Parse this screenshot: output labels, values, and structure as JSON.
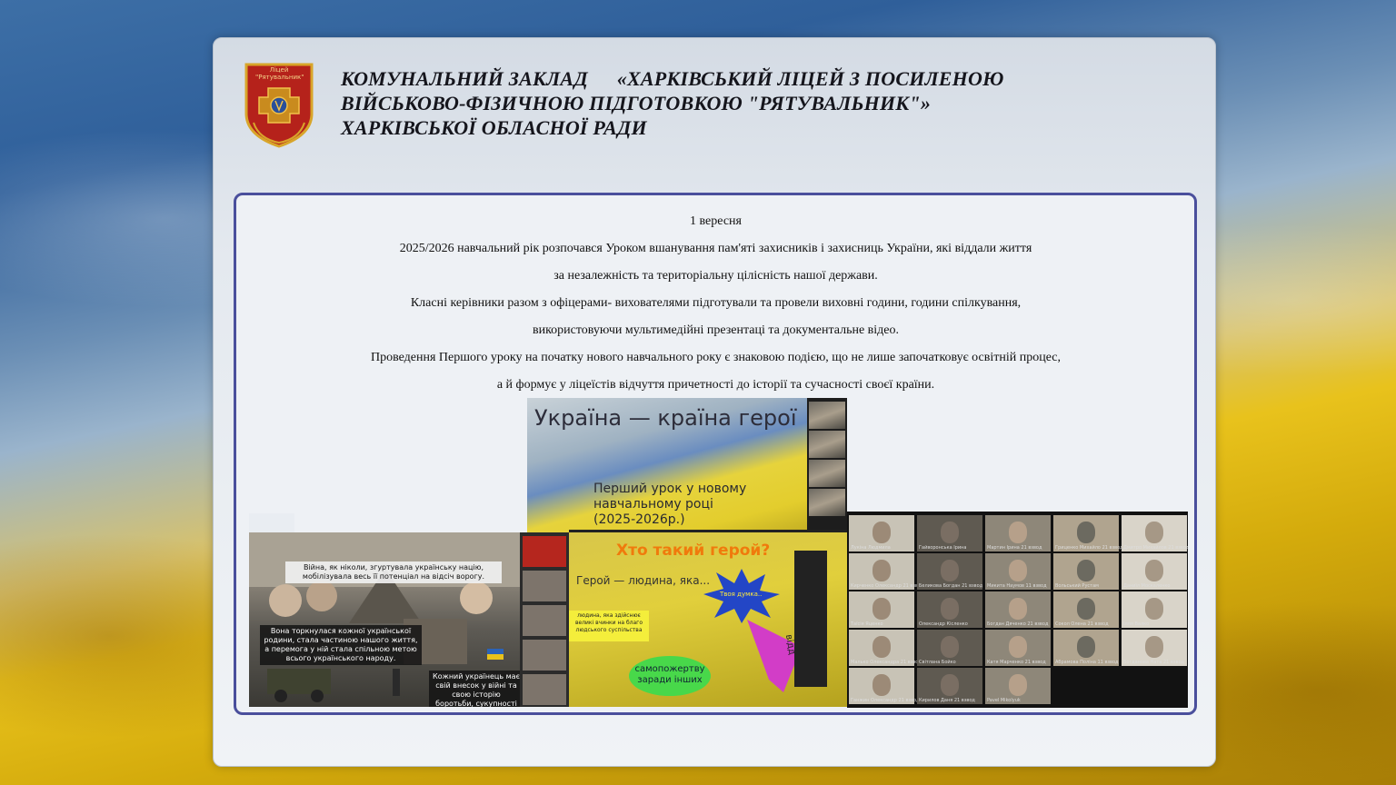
{
  "header": {
    "emblem_text": "Ліцей \"Рятувальник\"",
    "title_line1_a": "КОМУНАЛЬНИЙ ЗАКЛАД",
    "title_line1_b": "«ХАРКІВСЬКИЙ ЛІЦЕЙ З ПОСИЛЕНОЮ",
    "title_line2": "ВІЙСЬКОВО-ФІЗИЧНОЮ ПІДГОТОВКОЮ \"РЯТУВАЛЬНИК\"»",
    "title_line3": "ХАРКІВСЬКОЇ ОБЛАСНОЇ РАДИ"
  },
  "article": {
    "paragraphs": [
      "1 вересня",
      "2025/2026 навчальний рік розпочався Уроком вшанування пам'яті захисників і захисниць України, які віддали життя",
      "за незалежність та територіальну цілісність нашої держави.",
      "Класні керівники разом з офіцерами- вихователями підготували та провели виховні години, години спілкування,",
      "використовуючи мультимедійні презентаці та документальне відео.",
      "Проведення Першого уроку на початку нового навчального року є знаковою подією, що не лише започатковує освітній процес,",
      "а й формує у ліцеїстів відчуття причетності до історії та сучасності своєї країни."
    ]
  },
  "collage": {
    "slide1": {
      "title": "Україна — країна герої",
      "subtitle": "Перший урок у новому навчальному році (2025-2026р.)"
    },
    "slide2": {
      "box1": "Війна, як ніколи, згуртувала українську націю, мобілізувала весь її потенціал на відсіч ворогу.",
      "box2": "Вона торкнулася кожної української родини, стала частиною нашого життя, а перемога у ній стала спільною метою всього українського народу.",
      "box3": "Кожний українець має свій внесок у війні та свою історію боротьби, сукупності складають нашу історію спротиву"
    },
    "slide3": {
      "title": "Хто такий герой?",
      "definition": "Герой — людина, яка...",
      "star_text": "Твоя думка..",
      "yellow_text": "людина, яка здійснює великі вчинки на благо людського суспільства",
      "green_text": "самопожертву заради інших",
      "side_text": "відд"
    },
    "zoom_names": [
      "Лукіна Людмила",
      "Гайворонська Ірина",
      "Мартин Ірина 21 взвод",
      "Гриценко Михайло 21 взвод",
      "Дмитро Михайлов 21 взвод",
      "Кирченко Олександр 21 взвод",
      "Беликова Богдан 21 взвод",
      "Микита Наумов 11 взвод",
      "Вольський Рустам",
      "Даниїл Москаленко",
      "Таїсія Яценко",
      "Олександр Кісленко",
      "Богдан Дяченко 21 взвод",
      "Сокол Олена 21 взвод",
      "Ілля Валко",
      "Малько Олександра 21 взвод",
      "Світлана Бойко",
      "Катя Марченко 21 взвод",
      "Абрамова Поліна 11 взвод",
      "Богданова Ната 21 взвод",
      "Ганжин Олександр 21 взвод",
      "Кирилов Даня 21 взвод",
      "Pavel Mikolyuk"
    ]
  },
  "colors": {
    "frame_border": "#4a4f9c",
    "flag_blue": "#2f5f9a",
    "flag_yellow": "#e8c21c"
  }
}
